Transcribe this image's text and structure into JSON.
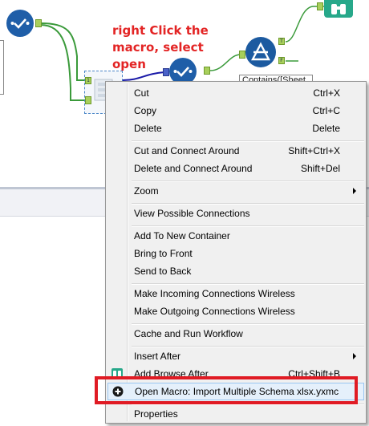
{
  "annotation": {
    "text": "right Click the\nmacro, select open",
    "color": "#e32424"
  },
  "canvas": {
    "contains_label": "Contains([Sheet",
    "anchors": {
      "macro_input": "1",
      "filter_true": "T",
      "filter_false": "F"
    }
  },
  "context_menu": {
    "items": [
      {
        "label": "Cut",
        "shortcut": "Ctrl+X"
      },
      {
        "label": "Copy",
        "shortcut": "Ctrl+C"
      },
      {
        "label": "Delete",
        "shortcut": "Delete"
      },
      {
        "label": "Cut and Connect Around",
        "shortcut": "Shift+Ctrl+X"
      },
      {
        "label": "Delete and Connect Around",
        "shortcut": "Shift+Del"
      },
      {
        "label": "Zoom",
        "shortcut": ""
      },
      {
        "label": "View Possible Connections",
        "shortcut": ""
      },
      {
        "label": "Add To New Container",
        "shortcut": ""
      },
      {
        "label": "Bring to Front",
        "shortcut": ""
      },
      {
        "label": "Send to Back",
        "shortcut": ""
      },
      {
        "label": "Make Incoming Connections Wireless",
        "shortcut": ""
      },
      {
        "label": "Make Outgoing Connections Wireless",
        "shortcut": ""
      },
      {
        "label": "Cache and Run Workflow",
        "shortcut": ""
      },
      {
        "label": "Insert After",
        "shortcut": ""
      },
      {
        "label": "Add Browse After",
        "shortcut": "Ctrl+Shift+B"
      },
      {
        "label": "Open Macro: Import Multiple Schema xlsx.yxmc",
        "shortcut": ""
      },
      {
        "label": "Properties",
        "shortcut": ""
      }
    ]
  },
  "colors": {
    "tool_blue": "#1f5ea8",
    "connection_green": "#3a9a3a",
    "browse_teal": "#27a88a",
    "highlight_red": "#e01b24"
  }
}
